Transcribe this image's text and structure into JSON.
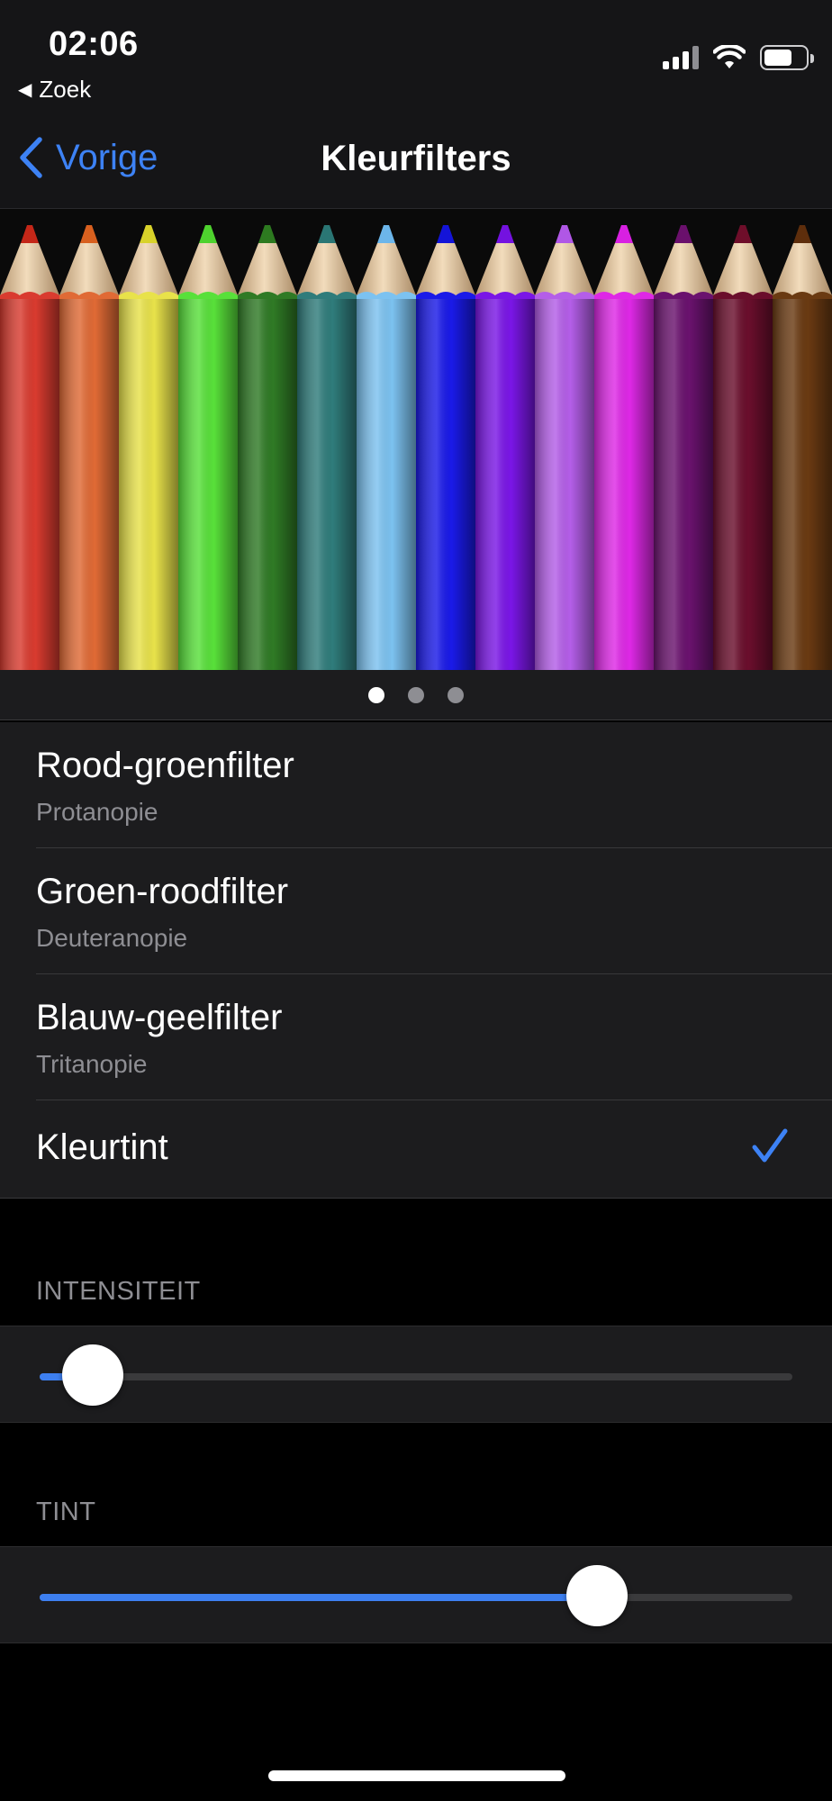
{
  "status_bar": {
    "time": "02:06",
    "back_app_label": "Zoek"
  },
  "nav": {
    "back_label": "Vorige",
    "title": "Kleurfilters"
  },
  "pencil_colors": [
    {
      "body": "#d93b2f",
      "tip": "#c42718"
    },
    {
      "body": "#e06a35",
      "tip": "#d8601f"
    },
    {
      "body": "#e8e24a",
      "tip": "#d8d22a"
    },
    {
      "body": "#58e03a",
      "tip": "#4ed22e"
    },
    {
      "body": "#2f7a25",
      "tip": "#2d7a20"
    },
    {
      "body": "#2f7c7b",
      "tip": "#2a7674"
    },
    {
      "body": "#7cc2f0",
      "tip": "#6cb6ea"
    },
    {
      "body": "#1a1ae8",
      "tip": "#1414d8"
    },
    {
      "body": "#7a16e6",
      "tip": "#7412e0"
    },
    {
      "body": "#b45ee8",
      "tip": "#b057e6"
    },
    {
      "body": "#de28e6",
      "tip": "#d820e2"
    },
    {
      "body": "#6a126e",
      "tip": "#6a106c"
    },
    {
      "body": "#6a0e2c",
      "tip": "#6e0e2a"
    },
    {
      "body": "#6a3a12",
      "tip": "#5e2e0c"
    }
  ],
  "pager": {
    "total": 3,
    "active_index": 0
  },
  "filters": [
    {
      "title": "Rood-groenfilter",
      "subtitle": "Protanopie",
      "checked": false
    },
    {
      "title": "Groen-roodfilter",
      "subtitle": "Deuteranopie",
      "checked": false
    },
    {
      "title": "Blauw-geelfilter",
      "subtitle": "Tritanopie",
      "checked": false
    },
    {
      "title": "Kleurtint",
      "subtitle": "",
      "checked": true
    }
  ],
  "intensity": {
    "header": "INTENSITEIT",
    "value": 0.07
  },
  "tint": {
    "header": "TINT",
    "value": 0.74
  },
  "colors": {
    "accent": "#3d82f5",
    "background": "#000000",
    "card": "#1c1c1e",
    "secondary_text": "#8e8e93"
  }
}
